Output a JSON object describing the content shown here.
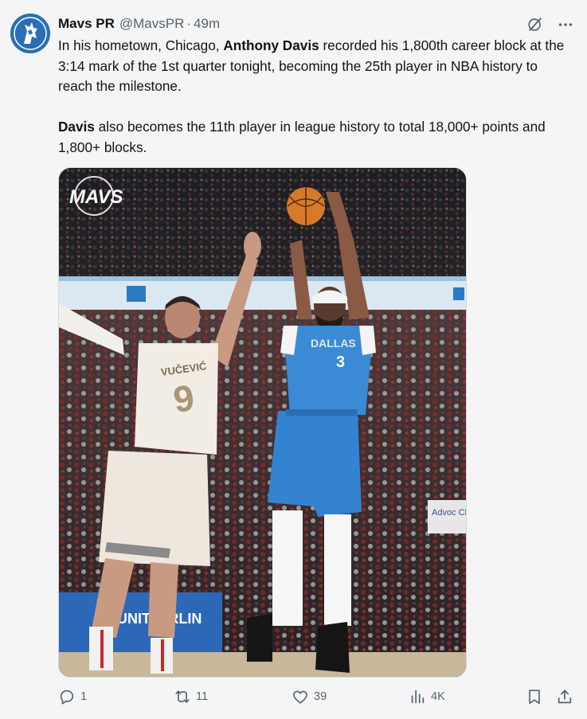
{
  "author": {
    "display_name": "Mavs PR",
    "handle": "@MavsPR",
    "separator": "·",
    "time": "49m",
    "avatar_icon": "mavericks-horse-logo",
    "avatar_color": "#2a6fb6"
  },
  "header_actions": {
    "grok_icon": "grok-slash-icon",
    "more_icon": "more-dots-icon"
  },
  "body": {
    "p1_prefix": "In his hometown, Chicago, ",
    "p1_bold": "Anthony Davis",
    "p1_suffix": " recorded his 1,800th career block at the 3:14 mark of the 1st quarter tonight, becoming the 25th player in NBA history to reach the milestone.",
    "p2_bold": "Davis",
    "p2_suffix": " also becomes the 11th player in league history to total 18,000+ points and 1,800+ blocks."
  },
  "media": {
    "watermark": "MAVS",
    "jersey_blue_text": "DALLAS",
    "jersey_blue_number": "3",
    "jersey_white_name": "VUČEVIĆ",
    "jersey_white_number": "9",
    "court_sign_text": "UNIT AIRLIN",
    "side_sign_text": "Advoc Child"
  },
  "actions": {
    "reply_count": "1",
    "repost_count": "11",
    "like_count": "39",
    "views_count": "4K",
    "icons": [
      "reply-icon",
      "repost-icon",
      "like-icon",
      "views-icon",
      "bookmark-icon",
      "share-icon"
    ],
    "icon_color": "#536471"
  }
}
